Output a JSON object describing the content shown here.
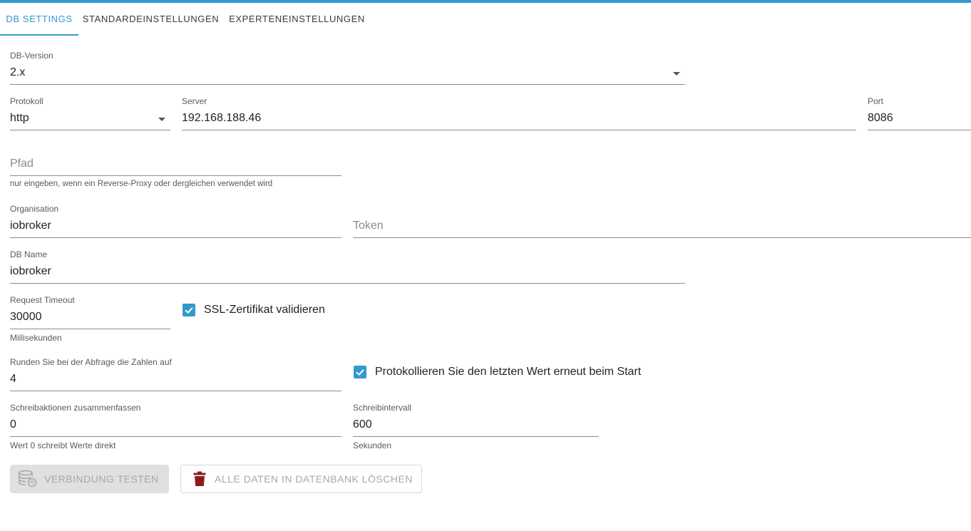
{
  "tabs": [
    {
      "label": "DB SETTINGS",
      "active": true
    },
    {
      "label": "STANDARDEINSTELLUNGEN",
      "active": false
    },
    {
      "label": "EXPERTENEINSTELLUNGEN",
      "active": false
    }
  ],
  "colors": {
    "accent": "#3399cc",
    "delete_icon": "#8b1a1a"
  },
  "fields": {
    "db_version": {
      "label": "DB-Version",
      "value": "2.x"
    },
    "protocol": {
      "label": "Protokoll",
      "value": "http"
    },
    "server": {
      "label": "Server",
      "value": "192.168.188.46"
    },
    "port": {
      "label": "Port",
      "value": "8086"
    },
    "path": {
      "placeholder": "Pfad",
      "helper": "nur eingeben, wenn ein Reverse-Proxy oder dergleichen verwendet wird"
    },
    "organisation": {
      "label": "Organisation",
      "value": "iobroker"
    },
    "token": {
      "placeholder": "Token"
    },
    "db_name": {
      "label": "DB Name",
      "value": "iobroker"
    },
    "request_timeout": {
      "label": "Request Timeout",
      "value": "30000",
      "helper": "Millisekunden"
    },
    "round": {
      "label": "Runden Sie bei der Abfrage die Zahlen auf",
      "value": "4"
    },
    "combine_writes": {
      "label": "Schreibaktionen zusammenfassen",
      "value": "0",
      "helper": "Wert 0 schreibt Werte direkt"
    },
    "write_interval": {
      "label": "Schreibintervall",
      "value": "600",
      "helper": "Sekunden"
    }
  },
  "checkboxes": {
    "ssl_validate": {
      "label": "SSL-Zertifikat validieren",
      "checked": true
    },
    "log_last_value": {
      "label": "Protokollieren Sie den letzten Wert erneut beim Start",
      "checked": true
    }
  },
  "buttons": {
    "test_connection": {
      "label": "VERBINDUNG TESTEN",
      "icon": "database-icon"
    },
    "delete_all": {
      "label": "ALLE DATEN IN DATENBANK LÖSCHEN",
      "icon": "trash-icon"
    }
  }
}
